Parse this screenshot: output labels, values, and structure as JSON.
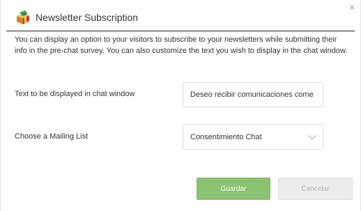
{
  "dialog": {
    "title": "Newsletter Subscription",
    "title_icon": "gift-box-icon",
    "close_label": "×",
    "description": "You can display an option to your visitors to subscribe to your newsletters while submitting their info in the pre-chat survey. You can also customize the text you wish to display in the chat window."
  },
  "form": {
    "chat_text": {
      "label": "Text to be displayed in chat window",
      "value": "Deseo recibir comunicaciones come"
    },
    "mailing_list": {
      "label": "Choose a Mailing List",
      "selected": "Consentimiento Chat"
    }
  },
  "buttons": {
    "save_label": "Guardar",
    "cancel_label": "Cancelar"
  },
  "colors": {
    "save_bg": "#8cc273",
    "cancel_bg": "#ececec",
    "divider": "#222222"
  }
}
